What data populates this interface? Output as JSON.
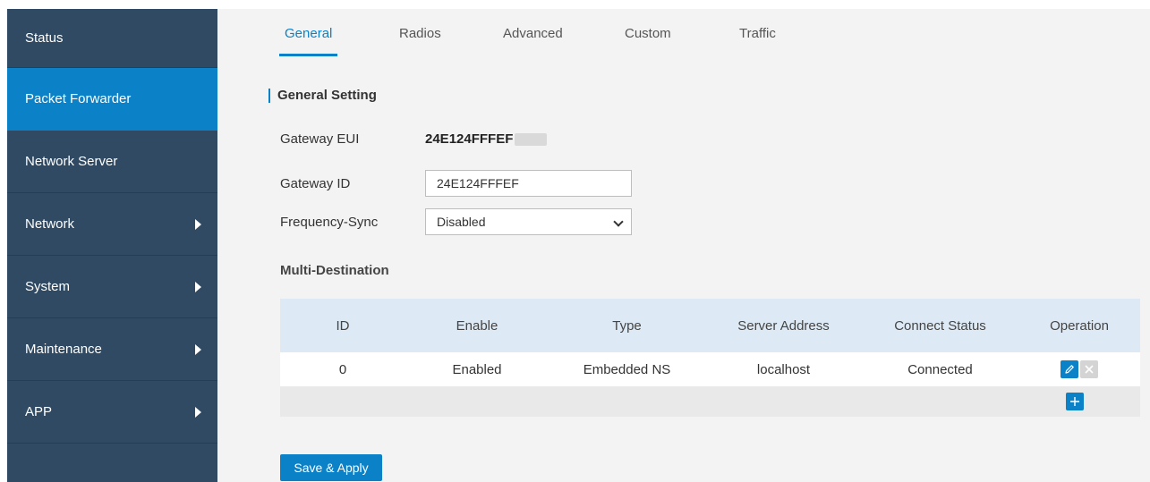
{
  "sidebar": {
    "items": [
      {
        "label": "Status",
        "has_arrow": false
      },
      {
        "label": "Packet Forwarder",
        "has_arrow": false,
        "active": true
      },
      {
        "label": "Network Server",
        "has_arrow": false
      },
      {
        "label": "Network",
        "has_arrow": true
      },
      {
        "label": "System",
        "has_arrow": true
      },
      {
        "label": "Maintenance",
        "has_arrow": true
      },
      {
        "label": "APP",
        "has_arrow": true
      }
    ]
  },
  "tabs": [
    {
      "label": "General",
      "active": true
    },
    {
      "label": "Radios"
    },
    {
      "label": "Advanced"
    },
    {
      "label": "Custom"
    },
    {
      "label": "Traffic"
    }
  ],
  "general": {
    "section_title": "General Setting",
    "gateway_eui_label": "Gateway EUI",
    "gateway_eui_value": "24E124FFFEF",
    "gateway_id_label": "Gateway ID",
    "gateway_id_value": "24E124FFFEF",
    "frequency_sync_label": "Frequency-Sync",
    "frequency_sync_value": "Disabled"
  },
  "multi_destination": {
    "title": "Multi-Destination",
    "columns": [
      "ID",
      "Enable",
      "Type",
      "Server Address",
      "Connect Status",
      "Operation"
    ],
    "rows": [
      {
        "id": "0",
        "enable": "Enabled",
        "type": "Embedded NS",
        "server_address": "localhost",
        "connect_status": "Connected"
      }
    ]
  },
  "actions": {
    "save_label": "Save & Apply"
  },
  "colors": {
    "accent": "#0b81c7",
    "sidebar_bg": "#2f4a62",
    "content_bg": "#f3f3f3",
    "table_header_bg": "#ddeaf5"
  },
  "icons": {
    "edit": "pencil-icon",
    "delete": "close-icon",
    "add": "plus-icon",
    "submenu": "chevron-right-icon"
  }
}
